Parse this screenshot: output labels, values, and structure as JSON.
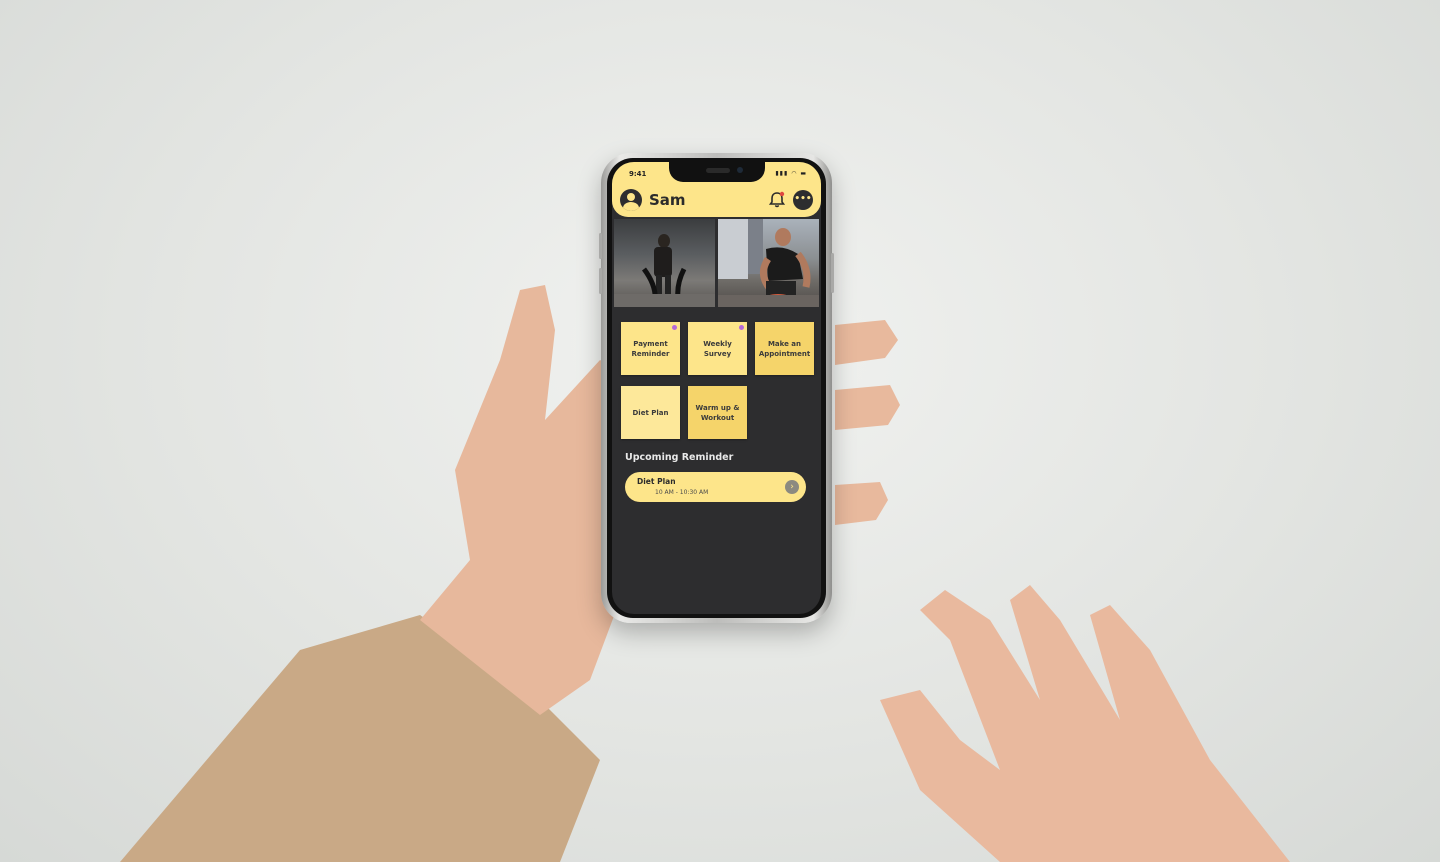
{
  "status_bar": {
    "time": "9:41",
    "icons": "▮▮▮ ◠ ▬"
  },
  "header": {
    "username": "Sam",
    "bell_icon": "bell-icon",
    "chat_icon": "chat-icon",
    "chat_glyph": "•••"
  },
  "photos": [
    {
      "icon": "fitness-photo-battle-ropes"
    },
    {
      "icon": "fitness-photo-lacing-shoes"
    }
  ],
  "tiles": [
    {
      "label": "Payment Reminder",
      "has_dot": true
    },
    {
      "label": "Weekly Survey",
      "has_dot": true
    },
    {
      "label": "Make an Appointment",
      "has_dot": false
    },
    {
      "label": "Diet Plan",
      "has_dot": false
    },
    {
      "label": "Warm up & Workout",
      "has_dot": false
    }
  ],
  "upcoming": {
    "section_title": "Upcoming Reminder",
    "item_title": "Diet Plan",
    "item_time": "10 AM - 10:30 AM",
    "arrow_glyph": "›"
  },
  "colors": {
    "accent": "#fde58a",
    "background_dark": "#2d2d2f",
    "dot": "#b66ad8"
  }
}
